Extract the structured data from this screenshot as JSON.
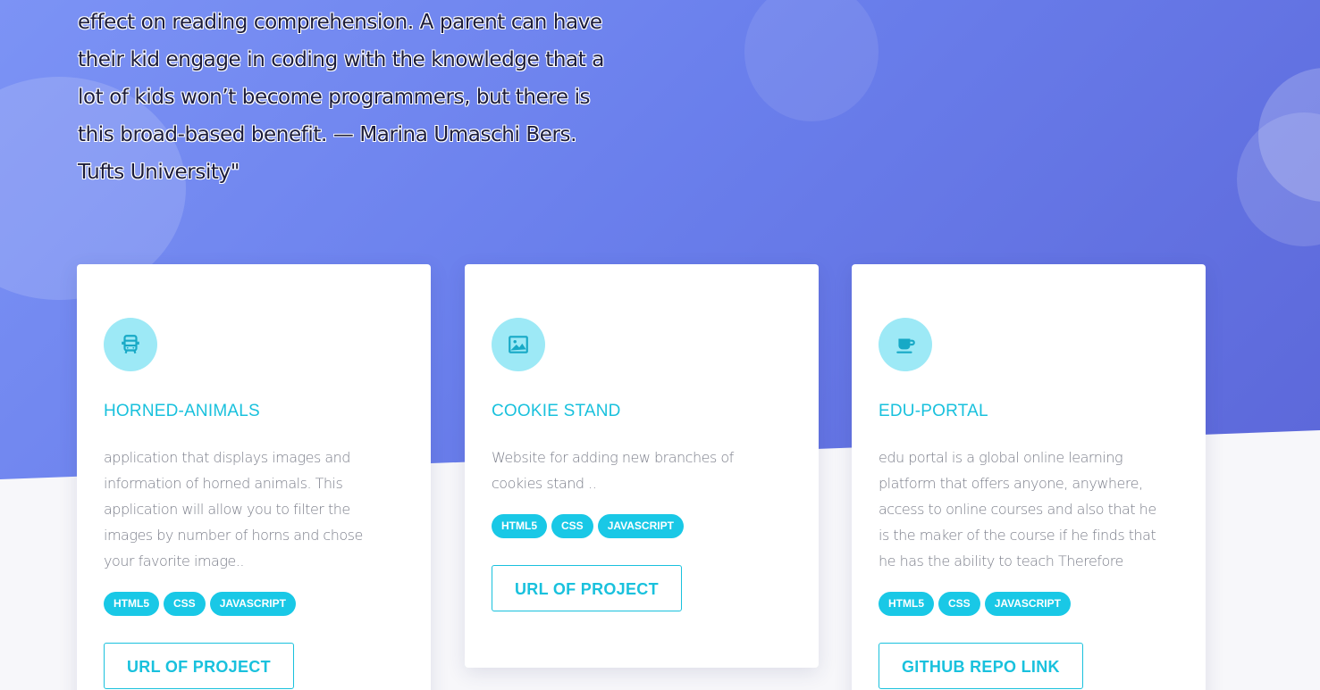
{
  "hero": {
    "quote_lines": [
      "effect on reading comprehension. A parent can have",
      "their kid engage in coding with the knowledge that a",
      "lot of kids won’t become programmers, but there is",
      "this broad-based benefit. — Marina Umaschi Bers.",
      "Tufts University\""
    ]
  },
  "colors": {
    "accent": "#19c1dd",
    "tag_bg": "#19c8e6",
    "icon_bg": "#9de9f6",
    "hero_gradient_start": "#7c93f5",
    "hero_gradient_end": "#5c67d9"
  },
  "projects": [
    {
      "icon": "bus-icon",
      "title": "HORNED-ANIMALS",
      "description": "application that displays images and information of horned animals. This application will allow you to filter the images by number of horns and chose your favorite image..",
      "tags": [
        "HTML5",
        "CSS",
        "JAVASCRIPT"
      ],
      "button_label": "URL OF PROJECT"
    },
    {
      "icon": "image-icon",
      "title": "COOKIE STAND",
      "description": "Website for adding new branches of cookies stand ..",
      "tags": [
        "HTML5",
        "CSS",
        "JAVASCRIPT"
      ],
      "button_label": "URL OF PROJECT"
    },
    {
      "icon": "coffee-cup-icon",
      "title": "EDU-PORTAL",
      "description": "edu portal is a global online learning platform that offers anyone, anywhere, access to online courses and also that he is the maker of the course if he finds that he has the ability to teach Therefore",
      "tags": [
        "HTML5",
        "CSS",
        "JAVASCRIPT"
      ],
      "button_label": "GITHUB REPO LINK"
    }
  ]
}
